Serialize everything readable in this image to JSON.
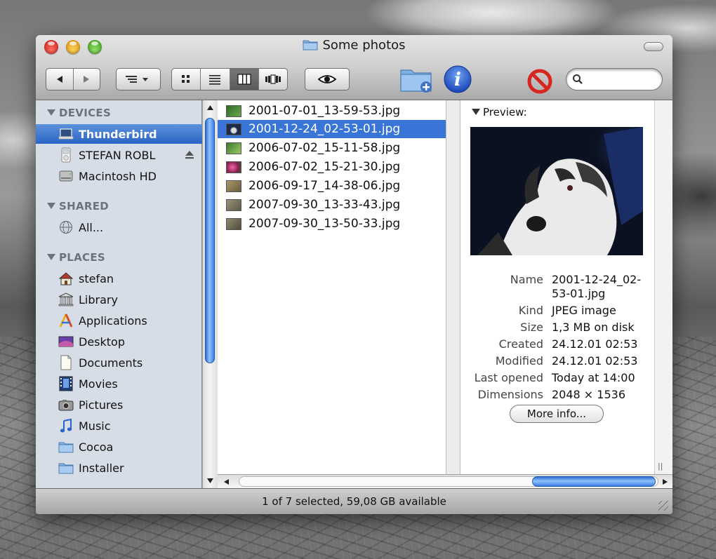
{
  "window": {
    "title": "Some photos"
  },
  "toolbar": {
    "back_icon": "back-arrow-icon",
    "forward_icon": "forward-arrow-icon",
    "action_icon": "action-menu-icon",
    "view_modes": [
      "icon-view",
      "list-view",
      "column-view",
      "coverflow-view"
    ],
    "active_view": "column-view",
    "quicklook_icon": "eye-icon",
    "new_folder_icon": "new-folder-icon",
    "info_icon": "info-icon",
    "info_letter": "i",
    "delete_icon": "no-entry-icon",
    "search_placeholder": ""
  },
  "sidebar": {
    "sections": [
      {
        "heading": "DEVICES",
        "items": [
          {
            "label": "Thunderbird",
            "icon": "laptop-icon",
            "selected": true
          },
          {
            "label": "STEFAN ROBL",
            "icon": "ipod-icon",
            "ejectable": true
          },
          {
            "label": "Macintosh HD",
            "icon": "hard-drive-icon"
          }
        ]
      },
      {
        "heading": "SHARED",
        "items": [
          {
            "label": "All...",
            "icon": "network-globe-icon"
          }
        ]
      },
      {
        "heading": "PLACES",
        "items": [
          {
            "label": "stefan",
            "icon": "home-icon"
          },
          {
            "label": "Library",
            "icon": "library-icon"
          },
          {
            "label": "Applications",
            "icon": "applications-icon"
          },
          {
            "label": "Desktop",
            "icon": "desktop-icon"
          },
          {
            "label": "Documents",
            "icon": "documents-icon"
          },
          {
            "label": "Movies",
            "icon": "movies-icon"
          },
          {
            "label": "Pictures",
            "icon": "pictures-icon"
          },
          {
            "label": "Music",
            "icon": "music-icon"
          },
          {
            "label": "Cocoa",
            "icon": "folder-icon"
          },
          {
            "label": "Installer",
            "icon": "folder-icon"
          }
        ]
      }
    ]
  },
  "files": [
    {
      "name": "2001-07-01_13-59-53.jpg",
      "thumb_color": "#3a7a2c"
    },
    {
      "name": "2001-12-24_02-53-01.jpg",
      "thumb_color": "#1d2a4a",
      "selected": true
    },
    {
      "name": "2006-07-02_15-11-58.jpg",
      "thumb_color": "#4f8b3a"
    },
    {
      "name": "2006-07-02_15-21-30.jpg",
      "thumb_color": "#c23a78"
    },
    {
      "name": "2006-09-17_14-38-06.jpg",
      "thumb_color": "#8b7a4a"
    },
    {
      "name": "2007-09-30_13-33-43.jpg",
      "thumb_color": "#7c7560"
    },
    {
      "name": "2007-09-30_13-50-33.jpg",
      "thumb_color": "#6f6a58"
    }
  ],
  "preview": {
    "heading": "Preview:",
    "info": [
      {
        "key": "Name",
        "value": "2001-12-24_02-53-01.jpg"
      },
      {
        "key": "Kind",
        "value": "JPEG image"
      },
      {
        "key": "Size",
        "value": "1,3 MB on disk"
      },
      {
        "key": "Created",
        "value": "24.12.01 02:53"
      },
      {
        "key": "Modified",
        "value": "24.12.01 02:53"
      },
      {
        "key": "Last opened",
        "value": "Today at 14:00"
      },
      {
        "key": "Dimensions",
        "value": "2048 × 1536"
      }
    ],
    "more_info_label": "More info..."
  },
  "status": {
    "text": "1 of 7 selected, 59,08 GB available"
  },
  "colors": {
    "selection": "#3875d7",
    "sidebar_bg": "#d6dde6",
    "sidebar_heading": "#6b7380"
  }
}
